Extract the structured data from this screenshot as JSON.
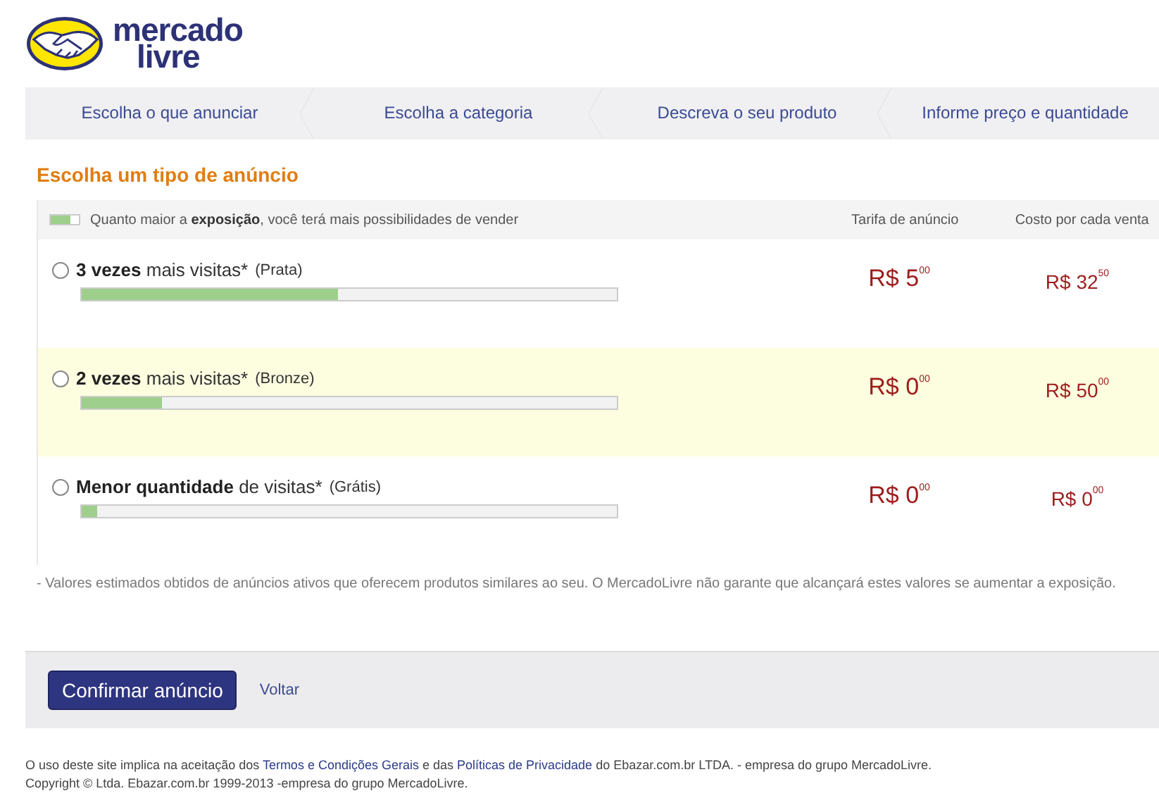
{
  "logo": {
    "line_1": "mercado",
    "line_2": "livre"
  },
  "steps": [
    "Escolha o que anunciar",
    "Escolha a categoria",
    "Descreva o seu produto",
    "Informe preço e quantidade"
  ],
  "section_title": "Escolha um tipo de anúncio",
  "table": {
    "legend": "Quanto maior a **exposição**, você terá mais possibilidades de vender",
    "columns": [
      "Tarifa de anúncio",
      "Costo por cada venta"
    ],
    "rows": [
      {
        "label": "**3 vezes** mais visitas*",
        "tier": "(Prata)",
        "selected": false,
        "highlighted": false,
        "level": 0.48,
        "fee": "R$ 5$^{00}$",
        "cost": "R$ 32$^{50}$"
      },
      {
        "label": "**2 vezes** mais visitas*",
        "tier": "(Bronze)",
        "selected": false,
        "highlighted": true,
        "level": 0.15,
        "fee": "R$ 0$^{00}$",
        "cost": "R$ 50$^{00}$"
      },
      {
        "label": "**Menor quantidade** de visitas*",
        "tier": "(Grátis)",
        "selected": false,
        "highlighted": false,
        "level": 0.03,
        "fee": "R$ 0$^{00}$",
        "cost": "R$ 0$^{00}$"
      }
    ]
  },
  "note": "- Valores estimados obtidos de anúncios ativos que oferecem produtos similares ao seu. O MercadoLivre não garante que alcançará estes valores se aumentar a exposição.",
  "actions": {
    "confirm": "Confirmar anúncio",
    "back": "Voltar"
  },
  "footer": {
    "terms": [
      {
        "kind": "text",
        "text": "O uso deste site implica na aceitação dos "
      },
      {
        "kind": "link",
        "text": "Termos e Condições Gerais"
      },
      {
        "kind": "text",
        "text": " e das "
      },
      {
        "kind": "link",
        "text": "Políticas de Privacidade"
      },
      {
        "kind": "text",
        "text": " do Ebazar.com.br LTDA. - empresa do grupo MercadoLivre."
      }
    ],
    "copyright": "Copyright © Ltda. Ebazar.com.br 1999-2013 -empresa do grupo MercadoLivre."
  }
}
